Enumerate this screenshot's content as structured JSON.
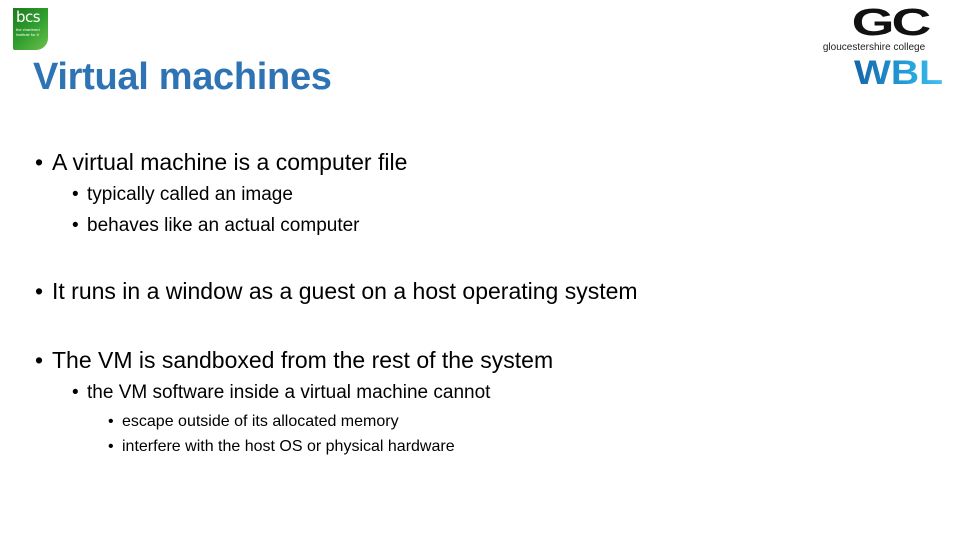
{
  "logos": {
    "bcs": {
      "name": "bcs",
      "tagline": "the chartered institute for it"
    },
    "college": {
      "name": "GC",
      "subtitle": "gloucestershire college"
    },
    "wbl": {
      "name": "WBL"
    }
  },
  "slide": {
    "title": "Virtual machines",
    "bullets": [
      {
        "level": 1,
        "text": "A virtual machine is a computer file"
      },
      {
        "level": 2,
        "text": "typically called an image"
      },
      {
        "level": 2,
        "text": "behaves like an actual computer"
      },
      {
        "level": 1,
        "text": "It runs in a window as a guest on a host operating system"
      },
      {
        "level": 1,
        "text": "The VM is sandboxed from the rest of the system"
      },
      {
        "level": 2,
        "text": "the VM software inside a virtual machine cannot"
      },
      {
        "level": 3,
        "text": "escape outside of its allocated memory"
      },
      {
        "level": 3,
        "text": "interfere with the host OS or physical hardware"
      }
    ]
  },
  "colors": {
    "title": "#2e74b5",
    "text": "#000000"
  }
}
